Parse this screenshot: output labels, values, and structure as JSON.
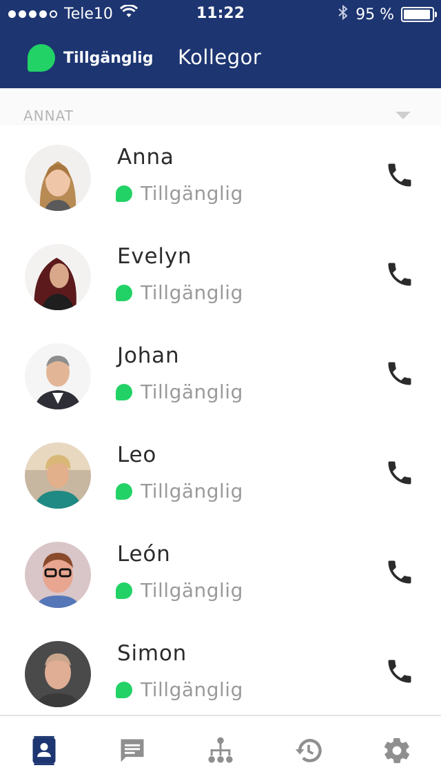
{
  "status_bar": {
    "carrier": "Tele10",
    "time": "11:22",
    "battery": "95 %",
    "battery_level": 0.95,
    "signal_bars": 4,
    "signal_max": 5
  },
  "header": {
    "presence_label": "Tillgänglig",
    "title": "Kollegor"
  },
  "section": {
    "label": "ANNAT"
  },
  "colors": {
    "header_bg": "#1d3571",
    "available": "#22d266",
    "tab_active": "#1d3571",
    "tab_inactive": "#8f8f8f"
  },
  "contacts": [
    {
      "name": "Anna",
      "status": "Tillgänglig",
      "avatar": "avatar-photo-anna"
    },
    {
      "name": "Evelyn",
      "status": "Tillgänglig",
      "avatar": "avatar-photo-evelyn"
    },
    {
      "name": "Johan",
      "status": "Tillgänglig",
      "avatar": "avatar-photo-johan"
    },
    {
      "name": "Leo",
      "status": "Tillgänglig",
      "avatar": "avatar-photo-leo"
    },
    {
      "name": "León",
      "status": "Tillgänglig",
      "avatar": "avatar-photo-leon"
    },
    {
      "name": "Simon",
      "status": "Tillgänglig",
      "avatar": "avatar-photo-simon"
    }
  ],
  "tabs": [
    {
      "icon": "contacts-icon",
      "active": true
    },
    {
      "icon": "chat-icon",
      "active": false
    },
    {
      "icon": "org-chart-icon",
      "active": false
    },
    {
      "icon": "history-icon",
      "active": false
    },
    {
      "icon": "settings-gear-icon",
      "active": false
    }
  ]
}
